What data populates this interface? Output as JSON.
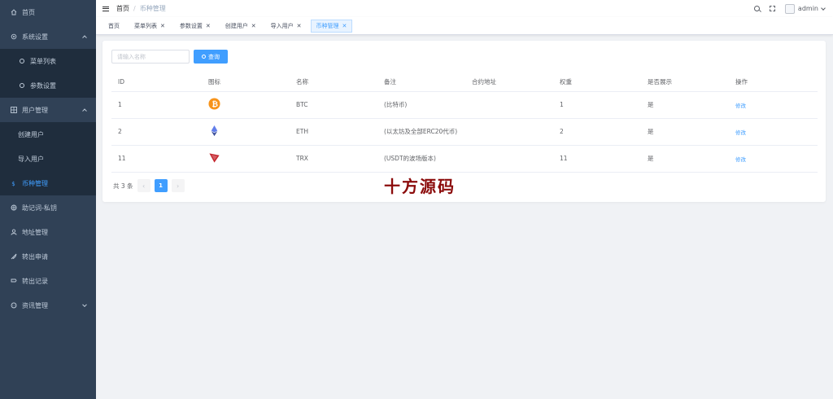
{
  "sidebar": {
    "items": [
      {
        "label": "首页",
        "icon": "home-icon"
      },
      {
        "label": "系统设置",
        "icon": "gear-icon",
        "expanded": true
      },
      {
        "label": "菜单列表",
        "icon": "circle-icon"
      },
      {
        "label": "参数设置",
        "icon": "circle-icon"
      },
      {
        "label": "用户管理",
        "icon": "grid-icon",
        "expanded": true
      },
      {
        "label": "创建用户"
      },
      {
        "label": "导入用户"
      },
      {
        "label": "币种管理",
        "icon": "coin-icon",
        "active": true
      },
      {
        "label": "助记词-私钥",
        "icon": "key-icon"
      },
      {
        "label": "地址管理",
        "icon": "user-icon"
      },
      {
        "label": "转出申请",
        "icon": "rocket-icon"
      },
      {
        "label": "转出记录",
        "icon": "receipt-icon"
      },
      {
        "label": "资讯管理",
        "icon": "chat-icon",
        "expanded": false
      }
    ]
  },
  "navbar": {
    "breadcrumb": [
      "首页",
      "币种管理"
    ],
    "breadcrumb_sep": "/",
    "username": "admin"
  },
  "tags": [
    {
      "label": "首页",
      "closable": false
    },
    {
      "label": "菜单列表",
      "closable": true
    },
    {
      "label": "参数设置",
      "closable": true
    },
    {
      "label": "创建用户",
      "closable": true
    },
    {
      "label": "导入用户",
      "closable": true
    },
    {
      "label": "币种管理",
      "closable": true,
      "active": true
    }
  ],
  "search": {
    "placeholder": "请输入名称",
    "value": "",
    "button_label": "查询"
  },
  "table": {
    "columns": [
      "ID",
      "图标",
      "名称",
      "备注",
      "合约地址",
      "权重",
      "是否展示",
      "操作"
    ],
    "rows": [
      {
        "id": "1",
        "icon": "bitcoin-icon",
        "name": "BTC",
        "note": "(比特币)",
        "contract": "",
        "weight": "1",
        "show": "是",
        "action": "修改"
      },
      {
        "id": "2",
        "icon": "ethereum-icon",
        "name": "ETH",
        "note": "(以太坊及全部ERC20代币)",
        "contract": "",
        "weight": "2",
        "show": "是",
        "action": "修改"
      },
      {
        "id": "11",
        "icon": "tron-icon",
        "name": "TRX",
        "note": "(USDT的波场版本)",
        "contract": "",
        "weight": "11",
        "show": "是",
        "action": "修改"
      }
    ]
  },
  "pagination": {
    "total_text": "共 3 条",
    "current_page": "1",
    "prev": "‹",
    "next": "›"
  },
  "watermark": "十方源码",
  "colors": {
    "sidebar_bg": "#304156",
    "sidebar_active_text": "#409eff",
    "primary": "#409eff",
    "watermark": "#8b0b0b",
    "btc": "#f7931a",
    "eth": "#627eea",
    "trx": "#c4262e"
  }
}
